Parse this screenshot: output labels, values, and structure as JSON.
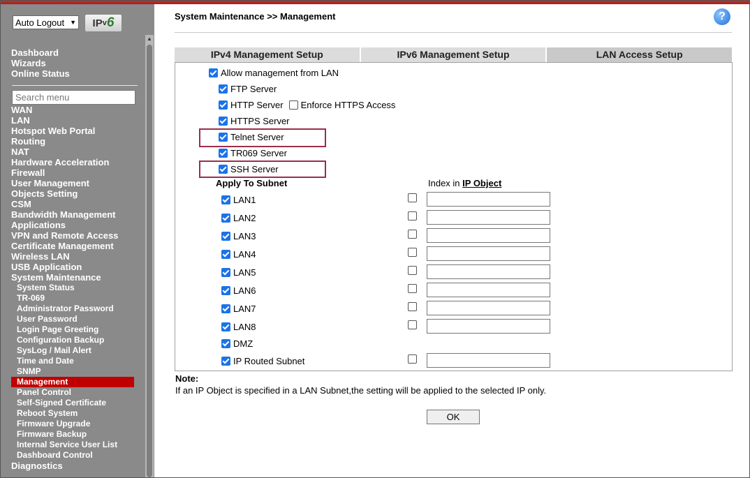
{
  "header": {
    "logout_select": "Auto Logout",
    "ipv6_prefix": "IP",
    "ipv6_v": "v",
    "ipv6_six": "6",
    "page_title": "System Maintenance >> Management",
    "help": "?"
  },
  "sidebar": {
    "top_items": [
      "Dashboard",
      "Wizards",
      "Online Status"
    ],
    "search_placeholder": "Search menu",
    "items": [
      "WAN",
      "LAN",
      "Hotspot Web Portal",
      "Routing",
      "NAT",
      "Hardware Acceleration",
      "Firewall",
      "User Management",
      "Objects Setting",
      "CSM",
      "Bandwidth Management",
      "Applications",
      "VPN and Remote Access",
      "Certificate Management",
      "Wireless LAN",
      "USB Application",
      "System Maintenance"
    ],
    "sub_items": [
      "System Status",
      "TR-069",
      "Administrator Password",
      "User Password",
      "Login Page Greeting",
      "Configuration Backup",
      "SysLog / Mail Alert",
      "Time and Date",
      "SNMP",
      "Management",
      "Panel Control",
      "Self-Signed Certificate",
      "Reboot System",
      "Firmware Upgrade",
      "Firmware Backup",
      "Internal Service User List",
      "Dashboard Control"
    ],
    "active_sub": "Management",
    "bottom_item": "Diagnostics"
  },
  "tabs": [
    "IPv4 Management Setup",
    "IPv6 Management Setup",
    "LAN Access Setup"
  ],
  "form": {
    "allow_lan": {
      "label": "Allow management from LAN",
      "checked": true
    },
    "ftp": {
      "label": "FTP Server",
      "checked": true
    },
    "http": {
      "label": "HTTP Server",
      "checked": true
    },
    "enforce_https": {
      "label": "Enforce HTTPS Access",
      "checked": false
    },
    "https": {
      "label": "HTTPS Server",
      "checked": true
    },
    "telnet": {
      "label": "Telnet Server",
      "checked": true
    },
    "tr069": {
      "label": "TR069 Server",
      "checked": true
    },
    "ssh": {
      "label": "SSH Server",
      "checked": true
    },
    "apply_subnet_header": "Apply To Subnet",
    "index_header_prefix": "Index in ",
    "index_header_link": "IP Object",
    "subnets": [
      {
        "label": "LAN1",
        "checked": true,
        "index_checked": false,
        "index_value": ""
      },
      {
        "label": "LAN2",
        "checked": true,
        "index_checked": false,
        "index_value": ""
      },
      {
        "label": "LAN3",
        "checked": true,
        "index_checked": false,
        "index_value": ""
      },
      {
        "label": "LAN4",
        "checked": true,
        "index_checked": false,
        "index_value": ""
      },
      {
        "label": "LAN5",
        "checked": true,
        "index_checked": false,
        "index_value": ""
      },
      {
        "label": "LAN6",
        "checked": true,
        "index_checked": false,
        "index_value": ""
      },
      {
        "label": "LAN7",
        "checked": true,
        "index_checked": false,
        "index_value": ""
      },
      {
        "label": "LAN8",
        "checked": true,
        "index_checked": false,
        "index_value": ""
      },
      {
        "label": "DMZ",
        "checked": true
      },
      {
        "label": "IP Routed Subnet",
        "checked": true,
        "index_checked": false,
        "index_value": ""
      }
    ]
  },
  "note": {
    "title": "Note:",
    "text": "If an IP Object is specified in a LAN Subnet,the setting will be applied to the selected IP only."
  },
  "ok_label": "OK"
}
